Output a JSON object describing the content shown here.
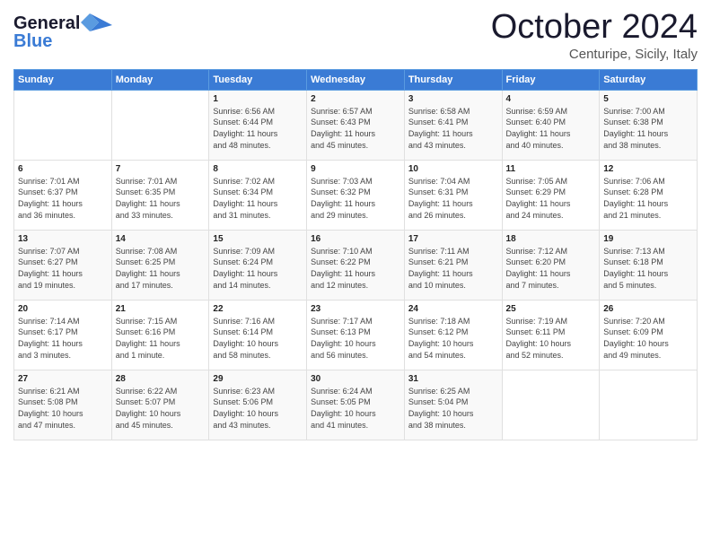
{
  "header": {
    "logo_line1": "General",
    "logo_line2": "Blue",
    "month": "October 2024",
    "location": "Centuripe, Sicily, Italy"
  },
  "days_of_week": [
    "Sunday",
    "Monday",
    "Tuesday",
    "Wednesday",
    "Thursday",
    "Friday",
    "Saturday"
  ],
  "weeks": [
    [
      {
        "num": "",
        "info": ""
      },
      {
        "num": "",
        "info": ""
      },
      {
        "num": "1",
        "info": "Sunrise: 6:56 AM\nSunset: 6:44 PM\nDaylight: 11 hours\nand 48 minutes."
      },
      {
        "num": "2",
        "info": "Sunrise: 6:57 AM\nSunset: 6:43 PM\nDaylight: 11 hours\nand 45 minutes."
      },
      {
        "num": "3",
        "info": "Sunrise: 6:58 AM\nSunset: 6:41 PM\nDaylight: 11 hours\nand 43 minutes."
      },
      {
        "num": "4",
        "info": "Sunrise: 6:59 AM\nSunset: 6:40 PM\nDaylight: 11 hours\nand 40 minutes."
      },
      {
        "num": "5",
        "info": "Sunrise: 7:00 AM\nSunset: 6:38 PM\nDaylight: 11 hours\nand 38 minutes."
      }
    ],
    [
      {
        "num": "6",
        "info": "Sunrise: 7:01 AM\nSunset: 6:37 PM\nDaylight: 11 hours\nand 36 minutes."
      },
      {
        "num": "7",
        "info": "Sunrise: 7:01 AM\nSunset: 6:35 PM\nDaylight: 11 hours\nand 33 minutes."
      },
      {
        "num": "8",
        "info": "Sunrise: 7:02 AM\nSunset: 6:34 PM\nDaylight: 11 hours\nand 31 minutes."
      },
      {
        "num": "9",
        "info": "Sunrise: 7:03 AM\nSunset: 6:32 PM\nDaylight: 11 hours\nand 29 minutes."
      },
      {
        "num": "10",
        "info": "Sunrise: 7:04 AM\nSunset: 6:31 PM\nDaylight: 11 hours\nand 26 minutes."
      },
      {
        "num": "11",
        "info": "Sunrise: 7:05 AM\nSunset: 6:29 PM\nDaylight: 11 hours\nand 24 minutes."
      },
      {
        "num": "12",
        "info": "Sunrise: 7:06 AM\nSunset: 6:28 PM\nDaylight: 11 hours\nand 21 minutes."
      }
    ],
    [
      {
        "num": "13",
        "info": "Sunrise: 7:07 AM\nSunset: 6:27 PM\nDaylight: 11 hours\nand 19 minutes."
      },
      {
        "num": "14",
        "info": "Sunrise: 7:08 AM\nSunset: 6:25 PM\nDaylight: 11 hours\nand 17 minutes."
      },
      {
        "num": "15",
        "info": "Sunrise: 7:09 AM\nSunset: 6:24 PM\nDaylight: 11 hours\nand 14 minutes."
      },
      {
        "num": "16",
        "info": "Sunrise: 7:10 AM\nSunset: 6:22 PM\nDaylight: 11 hours\nand 12 minutes."
      },
      {
        "num": "17",
        "info": "Sunrise: 7:11 AM\nSunset: 6:21 PM\nDaylight: 11 hours\nand 10 minutes."
      },
      {
        "num": "18",
        "info": "Sunrise: 7:12 AM\nSunset: 6:20 PM\nDaylight: 11 hours\nand 7 minutes."
      },
      {
        "num": "19",
        "info": "Sunrise: 7:13 AM\nSunset: 6:18 PM\nDaylight: 11 hours\nand 5 minutes."
      }
    ],
    [
      {
        "num": "20",
        "info": "Sunrise: 7:14 AM\nSunset: 6:17 PM\nDaylight: 11 hours\nand 3 minutes."
      },
      {
        "num": "21",
        "info": "Sunrise: 7:15 AM\nSunset: 6:16 PM\nDaylight: 11 hours\nand 1 minute."
      },
      {
        "num": "22",
        "info": "Sunrise: 7:16 AM\nSunset: 6:14 PM\nDaylight: 10 hours\nand 58 minutes."
      },
      {
        "num": "23",
        "info": "Sunrise: 7:17 AM\nSunset: 6:13 PM\nDaylight: 10 hours\nand 56 minutes."
      },
      {
        "num": "24",
        "info": "Sunrise: 7:18 AM\nSunset: 6:12 PM\nDaylight: 10 hours\nand 54 minutes."
      },
      {
        "num": "25",
        "info": "Sunrise: 7:19 AM\nSunset: 6:11 PM\nDaylight: 10 hours\nand 52 minutes."
      },
      {
        "num": "26",
        "info": "Sunrise: 7:20 AM\nSunset: 6:09 PM\nDaylight: 10 hours\nand 49 minutes."
      }
    ],
    [
      {
        "num": "27",
        "info": "Sunrise: 6:21 AM\nSunset: 5:08 PM\nDaylight: 10 hours\nand 47 minutes."
      },
      {
        "num": "28",
        "info": "Sunrise: 6:22 AM\nSunset: 5:07 PM\nDaylight: 10 hours\nand 45 minutes."
      },
      {
        "num": "29",
        "info": "Sunrise: 6:23 AM\nSunset: 5:06 PM\nDaylight: 10 hours\nand 43 minutes."
      },
      {
        "num": "30",
        "info": "Sunrise: 6:24 AM\nSunset: 5:05 PM\nDaylight: 10 hours\nand 41 minutes."
      },
      {
        "num": "31",
        "info": "Sunrise: 6:25 AM\nSunset: 5:04 PM\nDaylight: 10 hours\nand 38 minutes."
      },
      {
        "num": "",
        "info": ""
      },
      {
        "num": "",
        "info": ""
      }
    ]
  ]
}
